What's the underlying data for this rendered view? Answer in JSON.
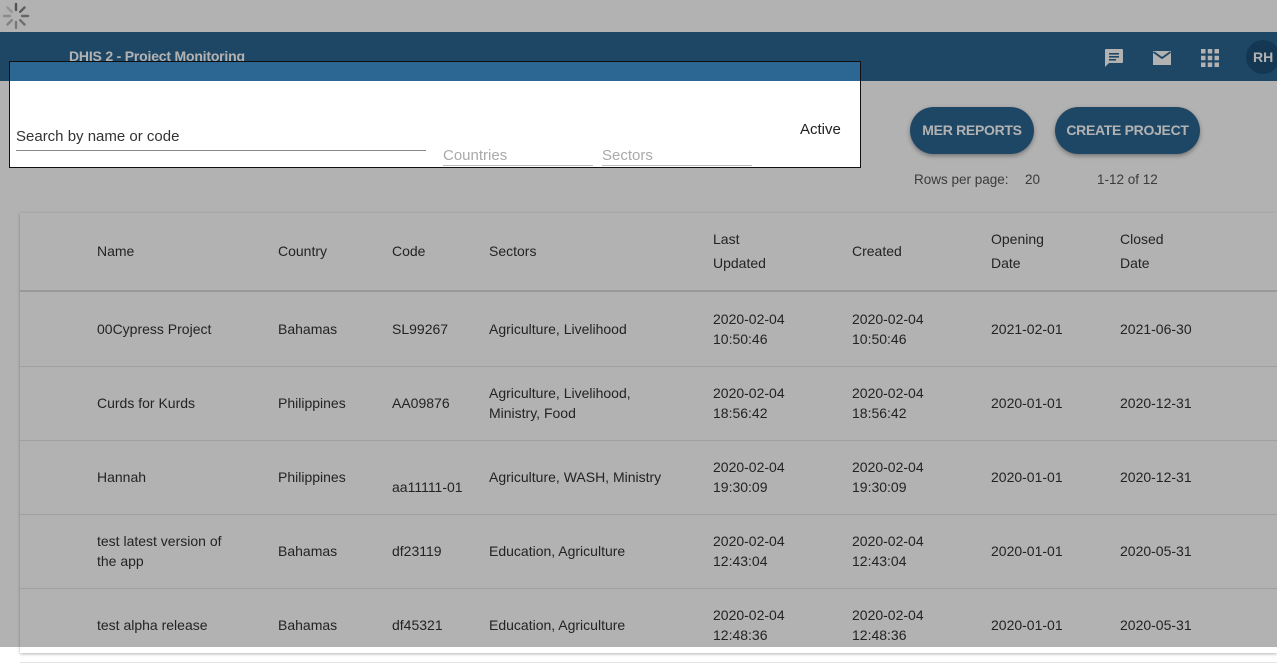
{
  "header": {
    "app_title": "DHIS 2 - Project Monitoring",
    "icons": [
      "chat-icon",
      "mail-icon",
      "apps-icon"
    ],
    "avatar": "RH",
    "bar_color": "#2c6693"
  },
  "actions": {
    "mer_reports": "MER REPORTS",
    "create_project": "CREATE PROJECT"
  },
  "pagination": {
    "rows_per_page_label": "Rows per page:",
    "rows_per_page": "20",
    "range": "1-12 of 12"
  },
  "filters": {
    "search_placeholder": "Search by name or code",
    "countries": "Countries",
    "sectors": "Sectors",
    "active_label": "Active"
  },
  "table": {
    "headers": {
      "name": "Name",
      "country": "Country",
      "code": "Code",
      "sectors": "Sectors",
      "last_updated": [
        "Last",
        "Updated"
      ],
      "created": "Created",
      "opening_date": [
        "Opening",
        "Date"
      ],
      "closed_date": [
        "Closed",
        "Date"
      ]
    },
    "rows": [
      {
        "name": [
          "00Cypress Project"
        ],
        "country": "Bahamas",
        "code": "SL99267",
        "sectors": [
          "Agriculture, Livelihood"
        ],
        "last_updated": [
          "2020-02-04",
          "10:50:46"
        ],
        "created": [
          "2020-02-04",
          "10:50:46"
        ],
        "opening": "2021-02-01",
        "closed": "2021-06-30"
      },
      {
        "name": [
          "Curds for Kurds"
        ],
        "country": "Philippines",
        "code": "AA09876",
        "sectors": [
          "Agriculture, Livelihood,",
          "Ministry, Food"
        ],
        "last_updated": [
          "2020-02-04",
          "18:56:42"
        ],
        "created": [
          "2020-02-04",
          "18:56:42"
        ],
        "opening": "2020-01-01",
        "closed": "2020-12-31"
      },
      {
        "name": [
          "Hannah"
        ],
        "country": "Philippines",
        "code": "aa11111-01",
        "sectors": [
          "Agriculture, WASH, Ministry"
        ],
        "last_updated": [
          "2020-02-04",
          "19:30:09"
        ],
        "created": [
          "2020-02-04",
          "19:30:09"
        ],
        "opening": "2020-01-01",
        "closed": "2020-12-31"
      },
      {
        "name": [
          "test latest version of",
          "the app"
        ],
        "country": "Bahamas",
        "code": "df23119",
        "sectors": [
          "Education, Agriculture"
        ],
        "last_updated": [
          "2020-02-04",
          "12:43:04"
        ],
        "created": [
          "2020-02-04",
          "12:43:04"
        ],
        "opening": "2020-01-01",
        "closed": "2020-05-31"
      },
      {
        "name": [
          "test alpha release"
        ],
        "country": "Bahamas",
        "code": "df45321",
        "sectors": [
          "Education, Agriculture"
        ],
        "last_updated": [
          "2020-02-04",
          "12:48:36"
        ],
        "created": [
          "2020-02-04",
          "12:48:36"
        ],
        "opening": "2020-01-01",
        "closed": "2020-05-31"
      }
    ]
  }
}
